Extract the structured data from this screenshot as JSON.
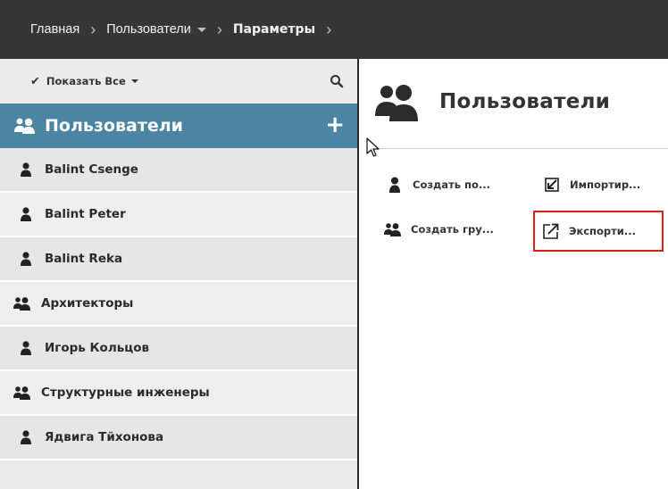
{
  "breadcrumb": {
    "items": [
      "Главная",
      "Пользователи",
      "Параметры"
    ]
  },
  "sidebar": {
    "filter_label": "Показать Все",
    "header_title": "Пользователи",
    "items": [
      {
        "label": "Balint Csenge",
        "type": "user"
      },
      {
        "label": "Balint Peter",
        "type": "user"
      },
      {
        "label": "Balint Reka",
        "type": "user"
      },
      {
        "label": "Архитекторы",
        "type": "group"
      },
      {
        "label": "Игорь Кольцов",
        "type": "user"
      },
      {
        "label": "Структурные инженеры",
        "type": "group"
      },
      {
        "label": "Ядвига Тйхонова",
        "type": "user"
      }
    ]
  },
  "main": {
    "title": "Пользователи",
    "actions": {
      "create_user": "Создать по...",
      "import": "Импортир...",
      "create_group": "Создать гру...",
      "export": "Экспорти..."
    }
  },
  "colors": {
    "topbar": "#363636",
    "header_accent": "#4a86a4",
    "highlight": "#e21b1b"
  },
  "icons": {
    "search": "search-icon",
    "add": "plus-icon",
    "user": "user-icon",
    "group": "group-icon",
    "import": "import-icon",
    "export": "export-icon"
  }
}
